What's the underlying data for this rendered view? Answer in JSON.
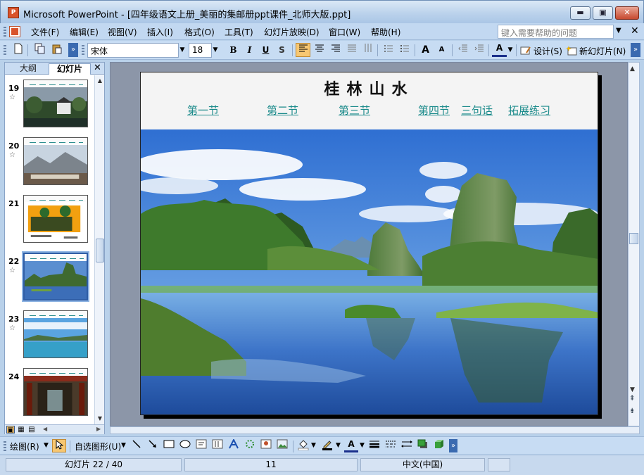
{
  "window": {
    "title": "Microsoft PowerPoint - [四年级语文上册_美丽的集邮册ppt课件_北师大版.ppt]",
    "app_icon_text": "P",
    "min_glyph": "▬",
    "max_glyph": "▣",
    "close_glyph": "✕"
  },
  "menu": {
    "items": [
      "文件(F)",
      "编辑(E)",
      "视图(V)",
      "插入(I)",
      "格式(O)",
      "工具(T)",
      "幻灯片放映(D)",
      "窗口(W)",
      "帮助(H)"
    ],
    "help_placeholder": "键入需要帮助的问题",
    "help_arrow": "▼",
    "close_glyph": "✕"
  },
  "toolbar": {
    "font": "宋体",
    "size": "18",
    "bold": "B",
    "italic": "I",
    "underline": "U",
    "shadow": "S",
    "design": "设计(S)",
    "new_slide": "新幻灯片(N)",
    "arrow": "▼",
    "more": "»",
    "font_grow": "A",
    "font_shrink": "A",
    "font_color": "A"
  },
  "left_pane": {
    "tab_outline": "大纲",
    "tab_slides": "幻灯片",
    "close_glyph": "✕",
    "star_glyph": "☆",
    "slides": [
      {
        "num": "19"
      },
      {
        "num": "20"
      },
      {
        "num": "21"
      },
      {
        "num": "22",
        "selected": true
      },
      {
        "num": "23"
      },
      {
        "num": "24"
      }
    ],
    "scroll_up": "▲",
    "scroll_down": "▼",
    "view_glyphs": [
      "▣",
      "▦",
      "▤"
    ],
    "hs_left": "◀",
    "hs_right": "▶"
  },
  "slide": {
    "title": "桂林山水",
    "links": [
      "第一节",
      "第二节",
      "第三节",
      "第四节",
      "三句话",
      "拓展练习"
    ]
  },
  "main_scroll": {
    "up": "▲",
    "down": "▼",
    "prev": "⇞",
    "next": "⇟"
  },
  "drawbar": {
    "draw_label": "绘图(R)",
    "autoshapes_label": "自选图形(U)",
    "arrow": "▼",
    "font_color": "A"
  },
  "status": {
    "slide_indicator": "幻灯片 22 / 40",
    "design_name": "11",
    "language": "中文(中国)"
  },
  "colors": {
    "link": "#1c8b8b",
    "selection": "#305ea6",
    "toolbar": "#c7dcf3"
  }
}
